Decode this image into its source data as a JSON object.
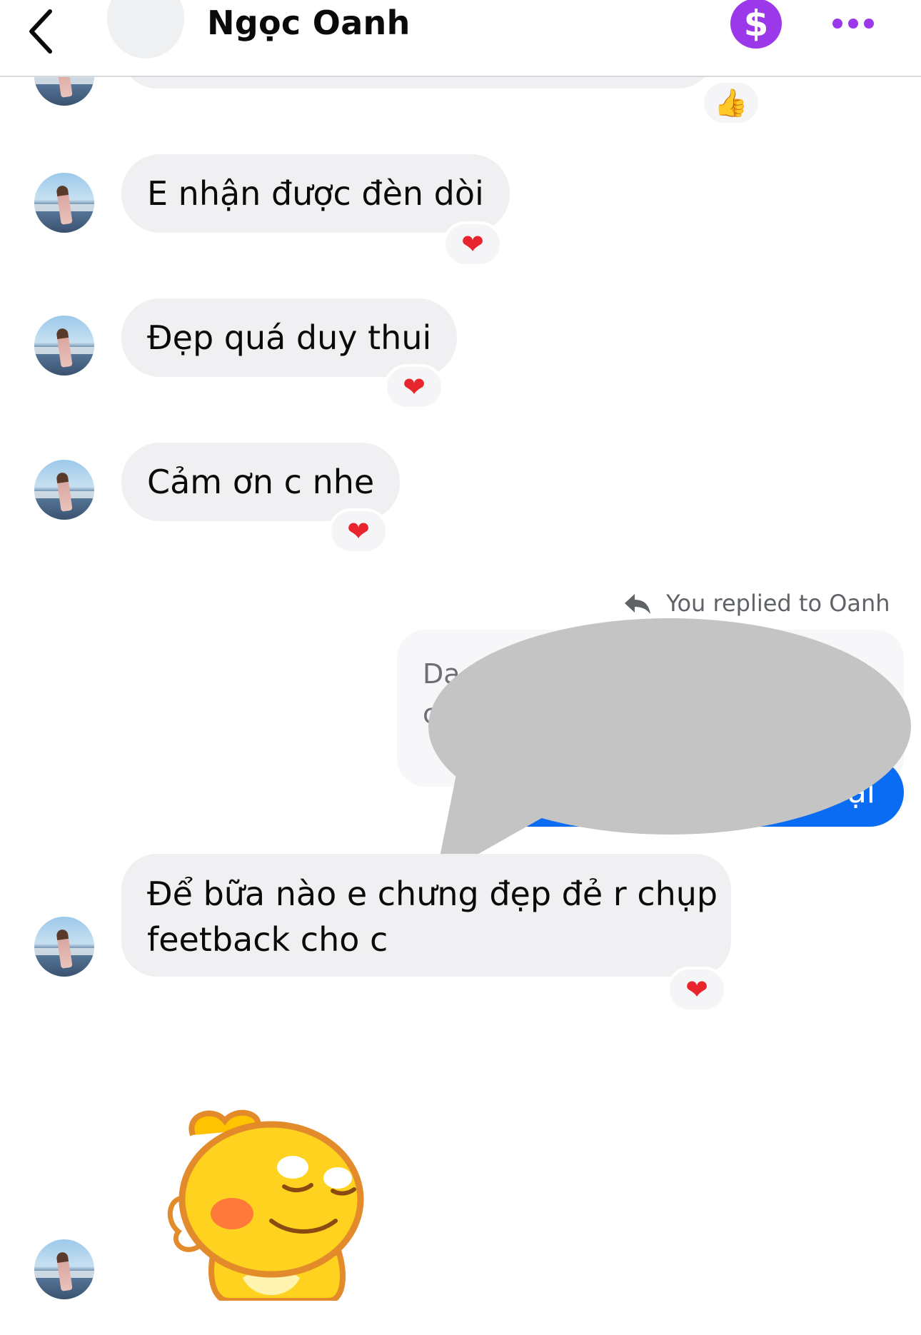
{
  "header": {
    "contact_name": "Ngọc Oanh",
    "pay_icon": "dollar-icon",
    "pay_symbol": "$",
    "accent_color": "#9b39ea"
  },
  "messages": [
    {
      "text": "E nhận được đèn dòi",
      "reaction": "❤"
    },
    {
      "text": "Đẹp quá duy thui",
      "reaction": "❤"
    },
    {
      "text": "Cảm ơn c nhe",
      "reaction": "❤"
    },
    {
      "text_line1": "Để bữa nào e chưng đẹp đẻ r chụp",
      "text_line2": "feetback cho c",
      "reaction": "❤"
    }
  ],
  "top_reaction": "👍",
  "reply": {
    "label": "You replied to Oanh",
    "quoted_visible_line1": "Da",
    "quoted_visible_line2": "c",
    "sent_visible_suffix": "ại",
    "sent_bubble_color": "#0a6cf3"
  },
  "sticker": {
    "name": "yellow-dinosaur-sticker"
  }
}
